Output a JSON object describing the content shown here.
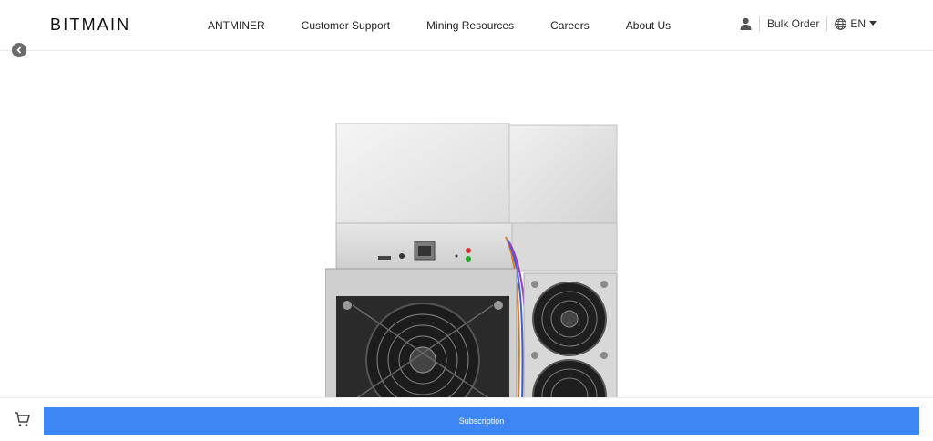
{
  "header": {
    "logo_text": "BITMAIN",
    "nav": [
      "ANTMINER",
      "Customer Support",
      "Mining Resources",
      "Careers",
      "About Us"
    ],
    "user_icon": "user-icon",
    "bulk_order": "Bulk Order",
    "language": "EN",
    "globe_icon": "globe-icon",
    "caret_icon": "caret-down-icon"
  },
  "back_icon": "chevron-left-icon",
  "product_image": "antminer-product-image",
  "bottom_bar": {
    "cart_icon": "cart-icon",
    "subscribe_label": "Subscription",
    "subscribe_color": "#3d86f5"
  }
}
